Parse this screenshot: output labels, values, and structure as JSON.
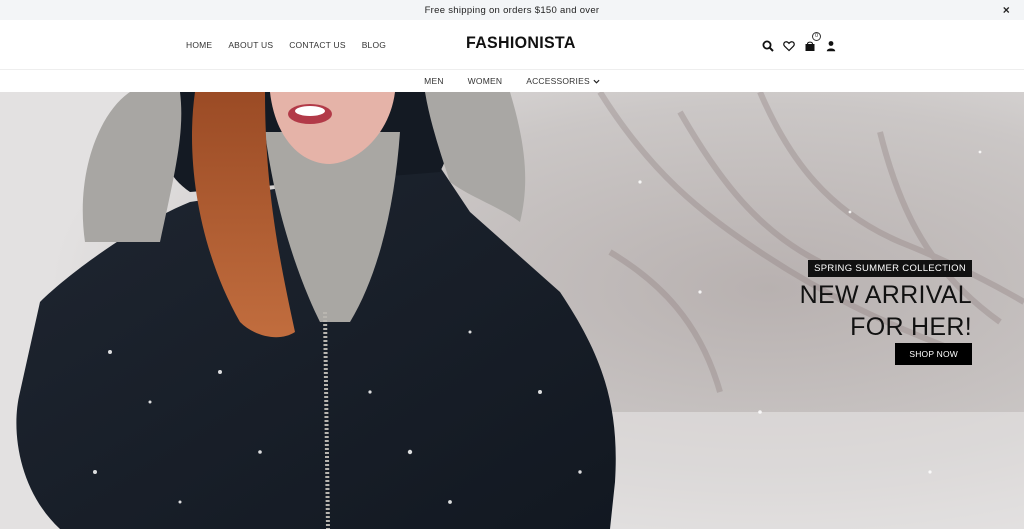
{
  "announcement": {
    "text": "Free shipping on orders $150 and over",
    "close_label": "×"
  },
  "header": {
    "logo": "FASHIONISTA",
    "nav": [
      "HOME",
      "ABOUT US",
      "CONTACT US",
      "BLOG"
    ],
    "cart_count": "0",
    "icons": [
      "search-icon",
      "heart-icon",
      "cart-icon",
      "user-icon"
    ]
  },
  "subnav": {
    "items": [
      "MEN",
      "WOMEN",
      "ACCESSORIES"
    ]
  },
  "hero": {
    "tag": "SPRING SUMMER COLLECTION",
    "title_line1": "NEW ARRIVAL",
    "title_line2": "FOR HER!",
    "button": "SHOP NOW"
  },
  "colors": {
    "topbar_bg": "#f3f5f7",
    "button_bg": "#000000",
    "text": "#111111"
  }
}
